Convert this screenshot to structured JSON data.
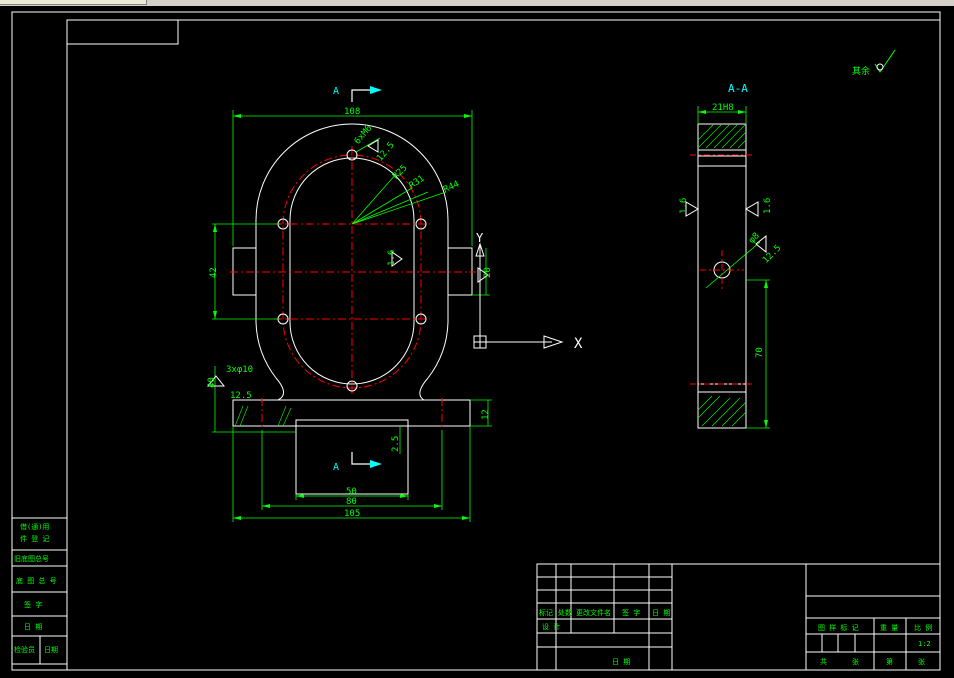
{
  "colors": {
    "background": "#000000",
    "frame": "#ffffff",
    "dimension": "#00ff00",
    "centerline": "#ff0000",
    "arrow": "#00ffff"
  },
  "section": {
    "marker_top": "A",
    "marker_bottom": "A",
    "title": "A-A"
  },
  "roughness": {
    "other": "其余",
    "r1": "12.5",
    "r2": "1.6",
    "r3": "12.5",
    "r4": "1.6",
    "r5": "1.6",
    "r6": "12.5"
  },
  "dims": {
    "top_width": "108",
    "hole_note": "6xM6",
    "r1": "R25",
    "r2": "R31",
    "r3": "R44",
    "left_height": "42",
    "lug_height": "20",
    "base_height": "40",
    "hole_3x": "3xφ10",
    "base_thk": "12",
    "slot_depth": "2.5",
    "w50": "50",
    "w80": "80",
    "w105": "105",
    "side_width": "21H8",
    "side_height": "70",
    "side_bore": "φ8"
  },
  "ucs": {
    "x_label": "X",
    "y_label": "Y"
  },
  "left_table": {
    "rows": [
      "借(通)用",
      "件 登 记",
      "旧底图总号",
      "底 图 总 号",
      "签  字",
      "日  期",
      "检验员",
      "日期"
    ]
  },
  "title_block": {
    "row1": [
      "标记",
      "处数",
      "更改文件名",
      "签 字",
      "日 期"
    ],
    "row2": [
      "设 计"
    ],
    "row3": [
      "日 期"
    ],
    "right1": [
      "图 样 标 记",
      "重 量",
      "比 例"
    ],
    "scale": "1:2",
    "right2": [
      "共",
      "张",
      "第",
      "张"
    ]
  }
}
